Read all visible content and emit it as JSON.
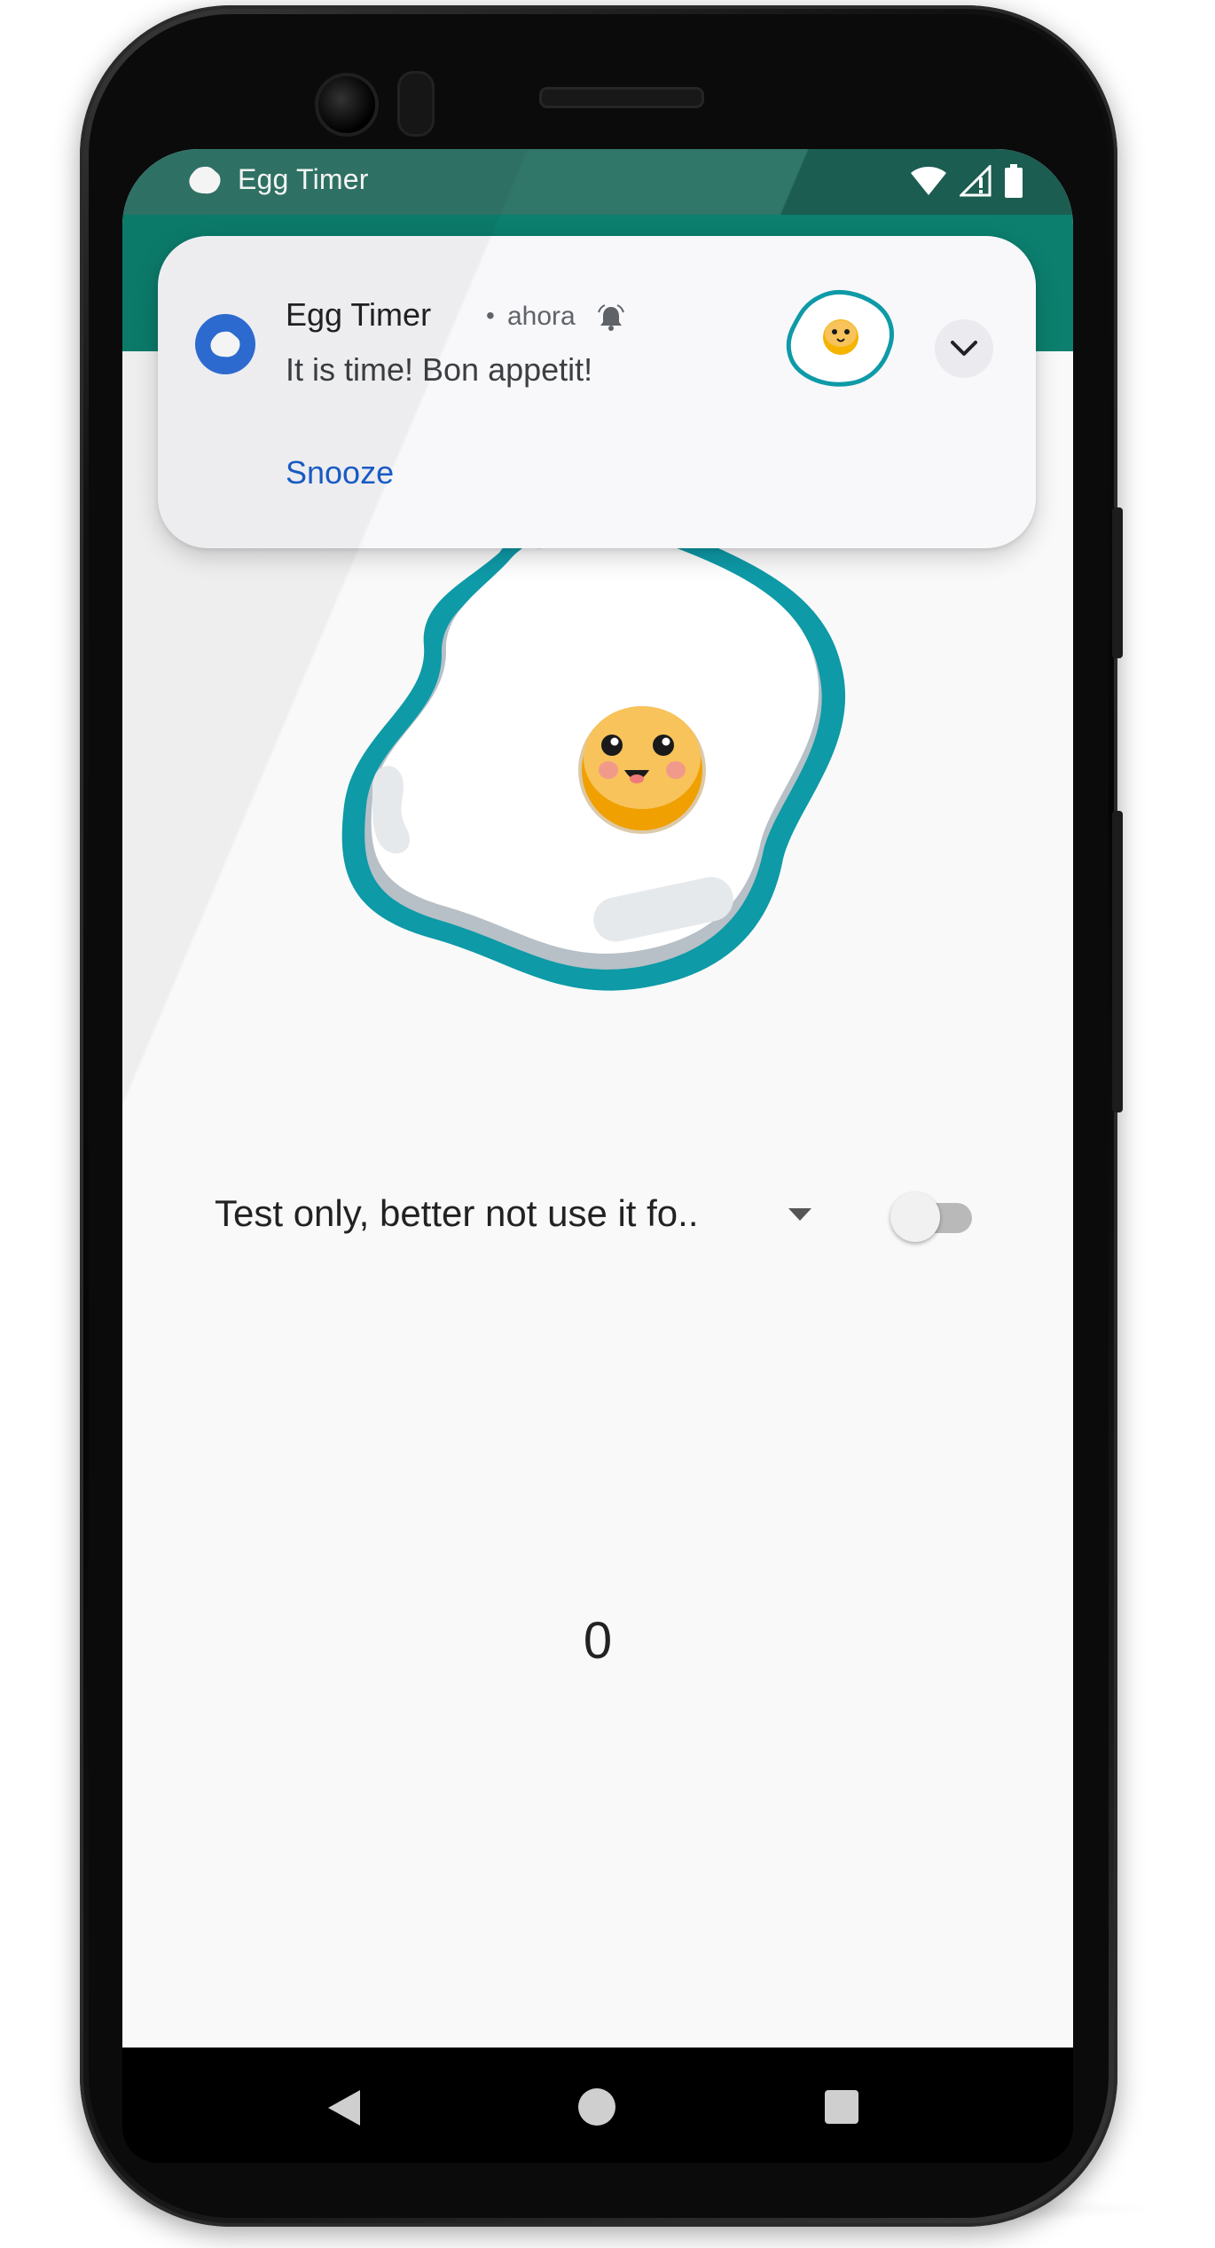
{
  "status_bar": {
    "app_title": "Egg Timer",
    "icons": [
      "wifi-icon",
      "cell-signal-icon",
      "battery-icon"
    ]
  },
  "notification": {
    "app_name": "Egg Timer",
    "separator": "•",
    "time": "ahora",
    "message": "It is time! Bon appetit!",
    "action_label": "Snooze",
    "icons": [
      "app-badge-icon",
      "bell-icon",
      "egg-thumbnail",
      "chevron-down-icon"
    ]
  },
  "main": {
    "spinner_value": "Test only, better not use it fo..",
    "switch_on": false,
    "counter": "0"
  },
  "colors": {
    "status_bar": "#1f6a5c",
    "app_bar": "#0c7f6e",
    "notification_link": "#1a5fcc",
    "notification_badge": "#2f6fd8",
    "egg_outline": "#0e9aa7",
    "yolk": "#f4b400"
  },
  "navigation": {
    "icons": [
      "back-icon",
      "home-icon",
      "recents-icon"
    ]
  }
}
